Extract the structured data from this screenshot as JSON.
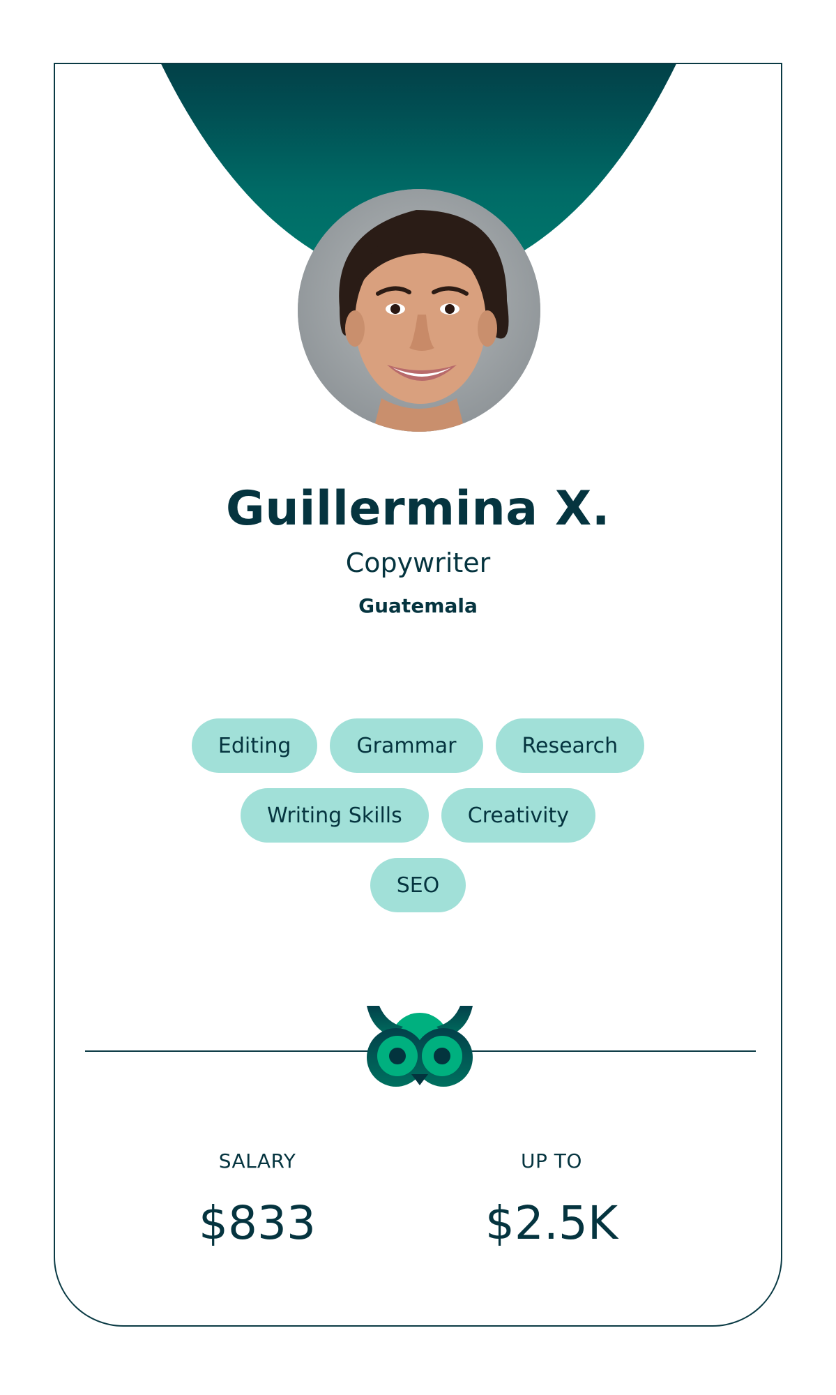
{
  "profile": {
    "name": "Guillermina X.",
    "role": "Copywriter",
    "location": "Guatemala",
    "avatar_icon": "person-photo"
  },
  "skills": {
    "rows": [
      [
        "Editing",
        "Grammar",
        "Research"
      ],
      [
        "Writing Skills",
        "Creativity"
      ],
      [
        "SEO"
      ]
    ]
  },
  "logo": {
    "icon": "owl-logo-icon"
  },
  "compensation": {
    "salary_label": "SALARY",
    "salary_value": "$833",
    "upto_label": "UP TO",
    "upto_value": "$2.5K"
  },
  "colors": {
    "primary_dark": "#05343f",
    "header_gradient_top": "#04333d",
    "header_gradient_bottom": "#007a6e",
    "tag_bg": "#a1e0d8",
    "owl_green": "#00b07f",
    "owl_dark": "#00625a"
  }
}
